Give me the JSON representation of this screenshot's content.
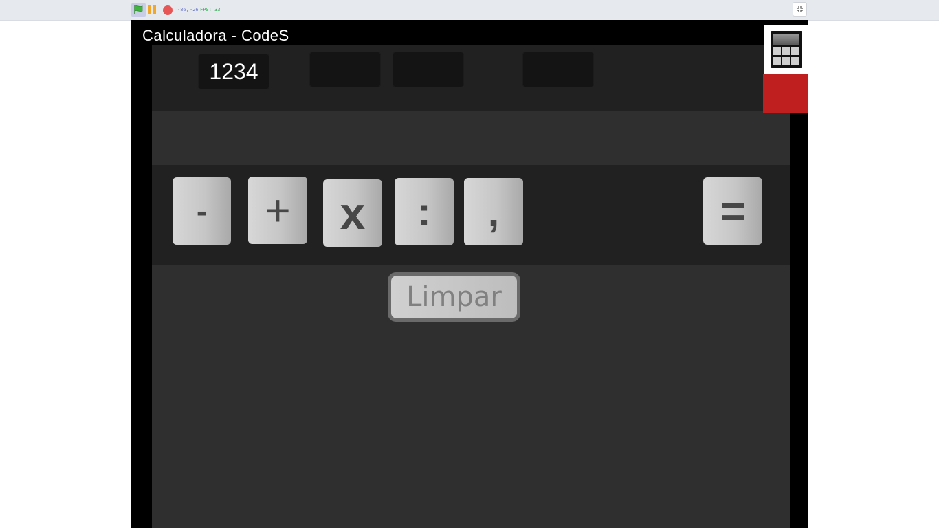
{
  "toolbar": {
    "green_flag": "green-flag",
    "pause": "pause",
    "stop": "stop",
    "stat_a": "-86,",
    "stat_b": "-26",
    "fps": "FPS: 33",
    "fullscreen": "exit-fullscreen"
  },
  "stage": {
    "title": "Calculadora - CodeS",
    "displays": [
      "1234",
      "",
      "",
      ""
    ],
    "keys": [
      {
        "label": "-",
        "name": "minus-key"
      },
      {
        "label": "+",
        "name": "plus-key"
      },
      {
        "label": "x",
        "name": "multiply-key"
      },
      {
        "label": ":",
        "name": "divide-key"
      },
      {
        "label": ",",
        "name": "comma-key"
      },
      {
        "label": "=",
        "name": "equals-key"
      }
    ],
    "clear_label": "Limpar"
  },
  "colors": {
    "stage_bg": "#000000",
    "panel_bg": "#2f2f2f",
    "band_bg": "#212121",
    "accent_red": "#bf1f1f",
    "fps_green": "#2aa84a"
  }
}
